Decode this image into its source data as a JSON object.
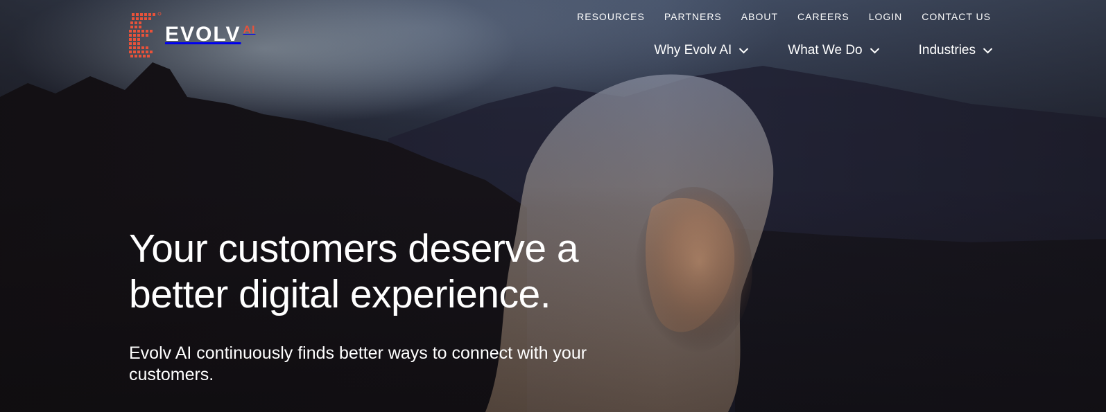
{
  "brand": {
    "name": "EVOLV",
    "suffix": "AI",
    "accent_color": "#e8523a"
  },
  "utility_nav": [
    {
      "label": "RESOURCES"
    },
    {
      "label": "PARTNERS"
    },
    {
      "label": "ABOUT"
    },
    {
      "label": "CAREERS"
    },
    {
      "label": "LOGIN"
    },
    {
      "label": "CONTACT US"
    }
  ],
  "main_nav": [
    {
      "label": "Why Evolv AI",
      "icon": "chevron-down-icon"
    },
    {
      "label": "What We Do",
      "icon": "chevron-down-icon"
    },
    {
      "label": "Industries",
      "icon": "chevron-down-icon"
    }
  ],
  "hero": {
    "headline_line1": "Your customers deserve a",
    "headline_line2": "better digital experience.",
    "subhead_line1": "Evolv AI continuously finds better ways to connect with your",
    "subhead_line2": "customers."
  }
}
